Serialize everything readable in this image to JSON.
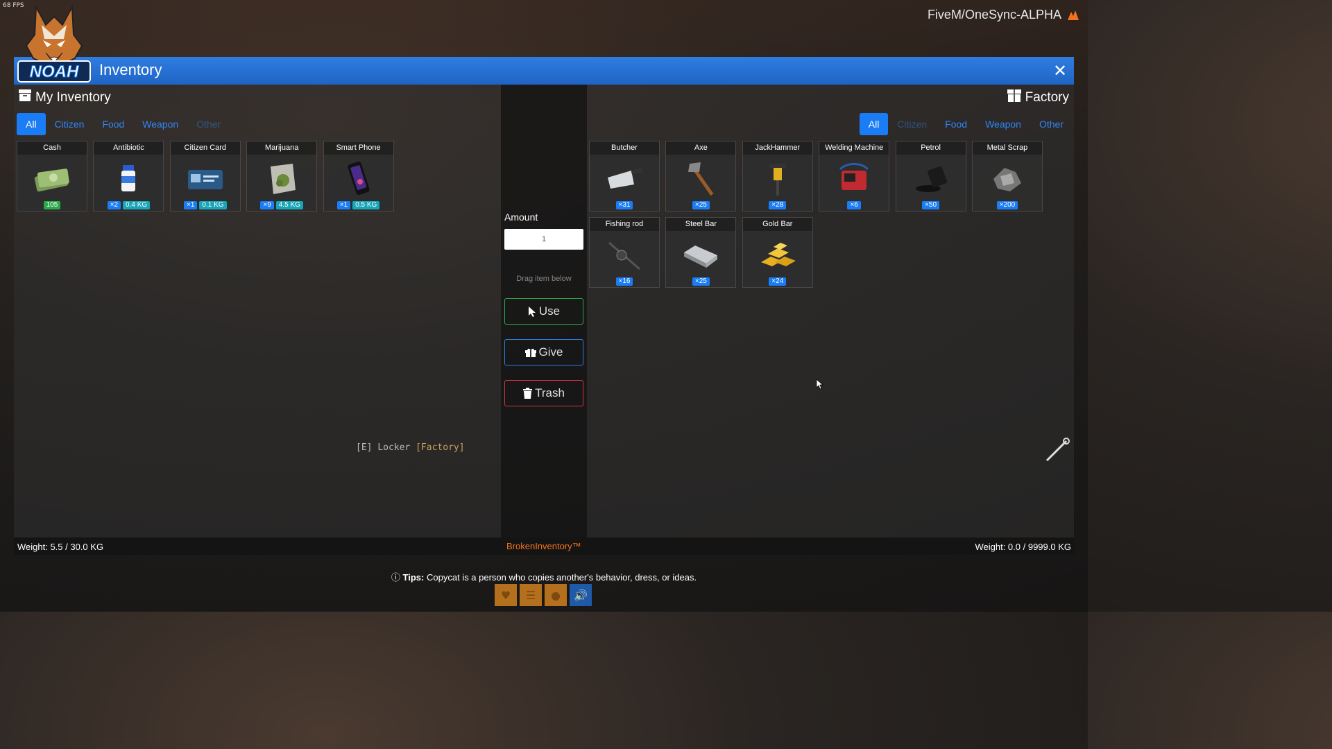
{
  "hud_top": {
    "fps": "68 FPS",
    "server": "FiveM/OneSync-ALPHA"
  },
  "logo_text": "NOAH",
  "header": {
    "title": "Inventory"
  },
  "left": {
    "title": "My Inventory",
    "tabs": [
      "All",
      "Citizen",
      "Food",
      "Weapon",
      "Other"
    ],
    "items": [
      {
        "name": "Cash",
        "icon": "cash-icon",
        "cash": "105"
      },
      {
        "name": "Antibiotic",
        "icon": "antibiotic-icon",
        "qty": "×2",
        "weight": "0.4 KG"
      },
      {
        "name": "Citizen Card",
        "icon": "citizen-card-icon",
        "qty": "×1",
        "weight": "0.1 KG"
      },
      {
        "name": "Marijuana",
        "icon": "marijuana-icon",
        "qty": "×9",
        "weight": "4.5 KG"
      },
      {
        "name": "Smart Phone",
        "icon": "smart-phone-icon",
        "qty": "×1",
        "weight": "0.5 KG"
      }
    ],
    "weight": "Weight: 5.5 / 30.0 KG"
  },
  "middle": {
    "amount_label": "Amount",
    "amount_value": "1",
    "drag_hint": "Drag item below",
    "use": "Use",
    "give": "Give",
    "trash": "Trash",
    "brand": "BrokenInventory™"
  },
  "right": {
    "title": "Factory",
    "tabs": [
      "All",
      "Citizen",
      "Food",
      "Weapon",
      "Other"
    ],
    "items": [
      {
        "name": "Butcher",
        "icon": "cleaver-icon",
        "qty": "×31"
      },
      {
        "name": "Axe",
        "icon": "axe-icon",
        "qty": "×25"
      },
      {
        "name": "JackHammer",
        "icon": "jackhammer-icon",
        "qty": "×28"
      },
      {
        "name": "Welding Machine",
        "icon": "welding-machine-icon",
        "qty": "×6"
      },
      {
        "name": "Petrol",
        "icon": "petrol-icon",
        "qty": "×50"
      },
      {
        "name": "Metal Scrap",
        "icon": "metal-scrap-icon",
        "qty": "×200"
      },
      {
        "name": "Fishing rod",
        "icon": "fishing-rod-icon",
        "qty": "×16"
      },
      {
        "name": "Steel Bar",
        "icon": "steel-bar-icon",
        "qty": "×25"
      },
      {
        "name": "Gold Bar",
        "icon": "gold-bar-icon",
        "qty": "×24"
      }
    ],
    "weight": "Weight: 0.0 / 9999.0 KG"
  },
  "tips": {
    "label": "Tips:",
    "text": "Copycat is a person who copies another's behavior, dress, or ideas."
  },
  "world": {
    "locker_key": "[E]",
    "locker_text": "Locker",
    "locker_place": "[Factory]"
  },
  "colors": {
    "accent": "#1b7df5",
    "header": "#2f7de1",
    "brand": "#f2731c",
    "use": "#2fa84d",
    "give": "#2d7de0",
    "trash": "#d6333f"
  }
}
